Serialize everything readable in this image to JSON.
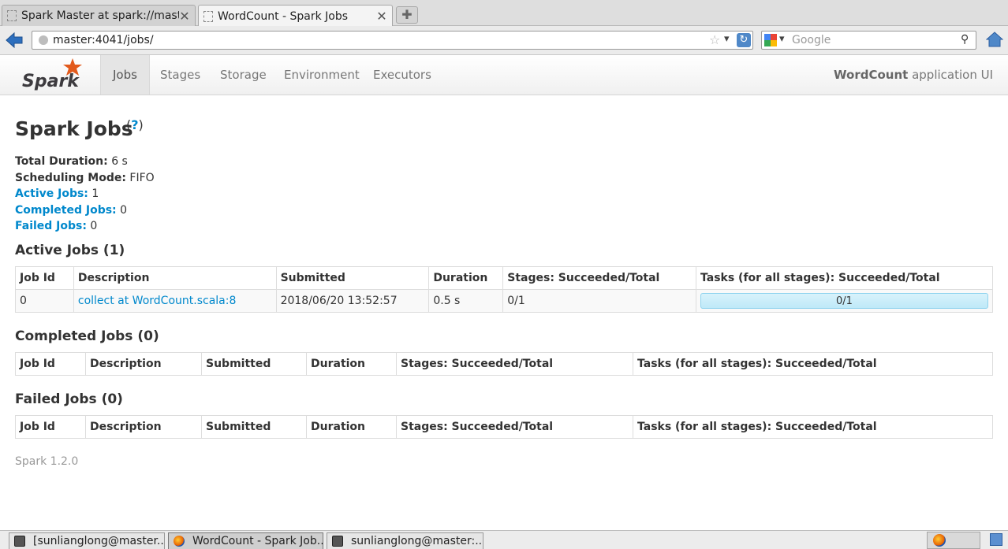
{
  "browser": {
    "tabs": [
      {
        "title": "Spark Master at spark://mast...",
        "active": false
      },
      {
        "title": "WordCount - Spark Jobs",
        "active": true
      }
    ],
    "url": "master:4041/jobs/",
    "search_placeholder": "Google"
  },
  "spark_nav": {
    "brand": "Spark",
    "items": [
      "Jobs",
      "Stages",
      "Storage",
      "Environment",
      "Executors"
    ],
    "active_item": "Jobs",
    "app_name": "WordCount",
    "app_suffix": " application UI"
  },
  "page": {
    "title": "Spark Jobs",
    "help": "?",
    "summary": {
      "total_duration_label": "Total Duration:",
      "total_duration": " 6 s",
      "scheduling_mode_label": "Scheduling Mode:",
      "scheduling_mode": " FIFO",
      "active_jobs_label": "Active Jobs:",
      "active_jobs": " 1",
      "completed_jobs_label": "Completed Jobs:",
      "completed_jobs": " 0",
      "failed_jobs_label": "Failed Jobs:",
      "failed_jobs": " 0"
    },
    "active_section_title": "Active Jobs (1)",
    "completed_section_title": "Completed Jobs (0)",
    "failed_section_title": "Failed Jobs (0)",
    "columns": [
      "Job Id",
      "Description",
      "Submitted",
      "Duration",
      "Stages: Succeeded/Total",
      "Tasks (for all stages): Succeeded/Total"
    ],
    "active_jobs": [
      {
        "job_id": "0",
        "description": "collect at WordCount.scala:8",
        "submitted": "2018/06/20 13:52:57",
        "duration": "0.5 s",
        "stages": "0/1",
        "tasks_text": "0/1",
        "tasks_fraction": 0.0
      }
    ],
    "footer": "Spark 1.2.0"
  },
  "taskbar": {
    "tasks": [
      {
        "label": "[sunlianglong@master...",
        "icon": "terminal-icon"
      },
      {
        "label": "WordCount - Spark Job...",
        "icon": "firefox-icon",
        "active": true
      },
      {
        "label": "sunlianglong@master:...",
        "icon": "terminal-icon"
      }
    ]
  }
}
